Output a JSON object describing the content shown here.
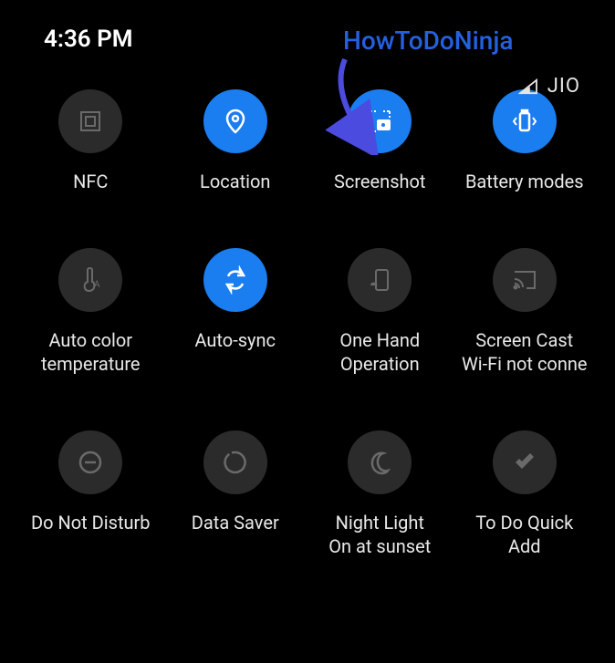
{
  "status": {
    "time": "4:36 PM",
    "carrier": "JIO"
  },
  "annotation": {
    "text": "HowToDoNinja"
  },
  "tiles": {
    "nfc": {
      "label": "NFC",
      "active": false
    },
    "location": {
      "label": "Location",
      "active": true
    },
    "screenshot": {
      "label": "Screenshot",
      "active": true
    },
    "battery": {
      "label": "Battery modes",
      "active": true
    },
    "autocolor": {
      "label": "Auto color\ntemperature",
      "active": false
    },
    "autosync": {
      "label": "Auto-sync",
      "active": true
    },
    "onehand": {
      "label": "One Hand\nOperation",
      "active": false
    },
    "screencast": {
      "label": "Screen Cast\nWi-Fi not conne",
      "active": false
    },
    "dnd": {
      "label": "Do Not Disturb",
      "active": false
    },
    "datasaver": {
      "label": "Data Saver",
      "active": false
    },
    "nightlight": {
      "label": "Night Light\nOn at sunset",
      "active": false
    },
    "todo": {
      "label": "To Do Quick\nAdd",
      "active": false
    }
  }
}
